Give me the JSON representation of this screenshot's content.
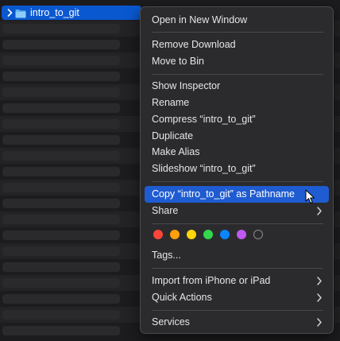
{
  "finder": {
    "selected_item": {
      "name": "intro_to_git",
      "icon": "folder-icon",
      "disclosure_icon": "chevron-right-icon"
    }
  },
  "context_menu": {
    "open_in_new_window": "Open in New Window",
    "remove_download": "Remove Download",
    "move_to_bin": "Move to Bin",
    "show_inspector": "Show Inspector",
    "rename": "Rename",
    "compress": "Compress “intro_to_git”",
    "duplicate": "Duplicate",
    "make_alias": "Make Alias",
    "slideshow": "Slideshow “intro_to_git”",
    "copy_as_pathname": "Copy “intro_to_git” as Pathname",
    "share": "Share",
    "tags": "Tags...",
    "import_from_iphone": "Import from iPhone or iPad",
    "quick_actions": "Quick Actions",
    "services": "Services",
    "tag_colors": [
      {
        "name": "red",
        "color": "#ff453a"
      },
      {
        "name": "orange",
        "color": "#ff9f0a"
      },
      {
        "name": "yellow",
        "color": "#ffd60a"
      },
      {
        "name": "green",
        "color": "#32d74b"
      },
      {
        "name": "blue",
        "color": "#0a84ff"
      },
      {
        "name": "purple",
        "color": "#bf5af2"
      },
      {
        "name": "gray",
        "color": "none"
      }
    ]
  },
  "colors": {
    "selection": "#0a58d0",
    "menu_highlight": "#1f5cd1",
    "menu_background": "#2b2b2d"
  }
}
